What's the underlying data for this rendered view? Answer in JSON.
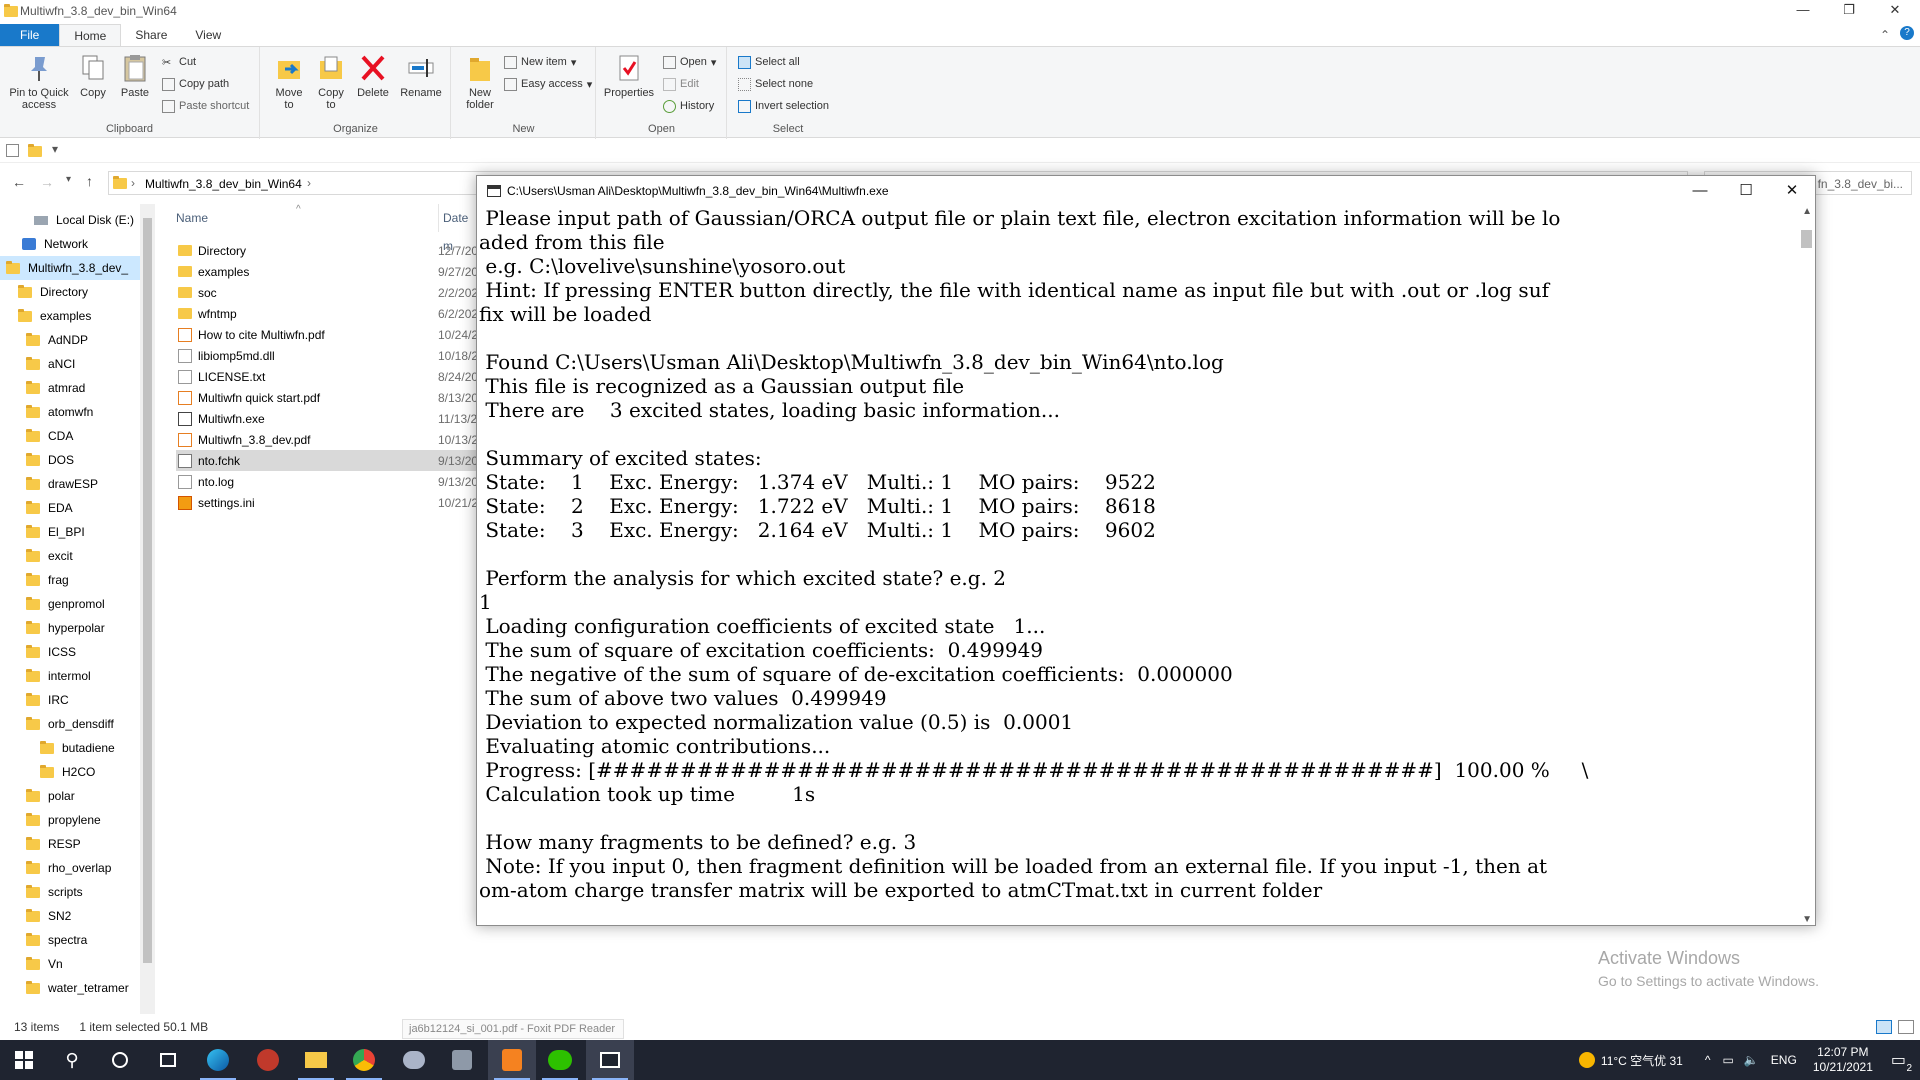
{
  "window": {
    "title": "Multiwfn_3.8_dev_bin_Win64"
  },
  "tabs": [
    "File",
    "Home",
    "Share",
    "View"
  ],
  "ribbon": {
    "clipboard": {
      "label": "Clipboard",
      "pin": "Pin to Quick access",
      "copy": "Copy",
      "paste": "Paste",
      "cut": "Cut",
      "copy_path": "Copy path",
      "paste_shortcut": "Paste shortcut"
    },
    "organize": {
      "label": "Organize",
      "move_to": "Move to",
      "copy_to": "Copy to",
      "delete": "Delete",
      "rename": "Rename"
    },
    "new": {
      "label": "New",
      "new_folder": "New folder",
      "new_item": "New item",
      "easy_access": "Easy access"
    },
    "open": {
      "label": "Open",
      "properties": "Properties",
      "open": "Open",
      "edit": "Edit",
      "history": "History"
    },
    "select": {
      "label": "Select",
      "select_all": "Select all",
      "select_none": "Select none",
      "invert": "Invert selection"
    }
  },
  "address": {
    "path": "Multiwfn_3.8_dev_bin_Win64",
    "search": "fn_3.8_dev_bi..."
  },
  "nav": {
    "items": [
      {
        "label": "Local Disk (E:)",
        "level": 1
      },
      {
        "label": "Network",
        "level": 0
      },
      {
        "label": "Multiwfn_3.8_dev_",
        "level": 0,
        "selected": true
      },
      {
        "label": "Directory",
        "level": 1
      },
      {
        "label": "examples",
        "level": 1
      },
      {
        "label": "AdNDP",
        "level": 2
      },
      {
        "label": "aNCI",
        "level": 2
      },
      {
        "label": "atmrad",
        "level": 2
      },
      {
        "label": "atomwfn",
        "level": 2
      },
      {
        "label": "CDA",
        "level": 2
      },
      {
        "label": "DOS",
        "level": 2
      },
      {
        "label": "drawESP",
        "level": 2
      },
      {
        "label": "EDA",
        "level": 2
      },
      {
        "label": "El_BPI",
        "level": 2
      },
      {
        "label": "excit",
        "level": 2
      },
      {
        "label": "frag",
        "level": 2
      },
      {
        "label": "genpromol",
        "level": 2
      },
      {
        "label": "hyperpolar",
        "level": 2
      },
      {
        "label": "ICSS",
        "level": 2
      },
      {
        "label": "intermol",
        "level": 2
      },
      {
        "label": "IRC",
        "level": 2
      },
      {
        "label": "orb_densdiff",
        "level": 2
      },
      {
        "label": "butadiene",
        "level": 3
      },
      {
        "label": "H2CO",
        "level": 3
      },
      {
        "label": "polar",
        "level": 2
      },
      {
        "label": "propylene",
        "level": 2
      },
      {
        "label": "RESP",
        "level": 2
      },
      {
        "label": "rho_overlap",
        "level": 2
      },
      {
        "label": "scripts",
        "level": 2
      },
      {
        "label": "SN2",
        "level": 2
      },
      {
        "label": "spectra",
        "level": 2
      },
      {
        "label": "Vn",
        "level": 2
      },
      {
        "label": "water_tetramer",
        "level": 2
      }
    ]
  },
  "files": {
    "headers": {
      "name": "Name",
      "date": "Date m"
    },
    "rows": [
      {
        "name": "Directory",
        "date": "12/7/20",
        "type": "folder"
      },
      {
        "name": "examples",
        "date": "9/27/20",
        "type": "folder"
      },
      {
        "name": "soc",
        "date": "2/2/202",
        "type": "folder"
      },
      {
        "name": "wfntmp",
        "date": "6/2/202",
        "type": "folder"
      },
      {
        "name": "How to cite Multiwfn.pdf",
        "date": "10/24/2",
        "type": "pdf"
      },
      {
        "name": "libiomp5md.dll",
        "date": "10/18/2",
        "type": "dll"
      },
      {
        "name": "LICENSE.txt",
        "date": "8/24/20",
        "type": "txt"
      },
      {
        "name": "Multiwfn quick start.pdf",
        "date": "8/13/20",
        "type": "pdf"
      },
      {
        "name": "Multiwfn.exe",
        "date": "11/13/2",
        "type": "exe"
      },
      {
        "name": "Multiwfn_3.8_dev.pdf",
        "date": "10/13/2",
        "type": "pdf"
      },
      {
        "name": "nto.fchk",
        "date": "9/13/20",
        "type": "fchk",
        "selected": true
      },
      {
        "name": "nto.log",
        "date": "9/13/20",
        "type": "txt"
      },
      {
        "name": "settings.ini",
        "date": "10/21/2",
        "type": "ini"
      }
    ]
  },
  "status": {
    "items": "13 items",
    "selected": "1 item selected  50.1 MB",
    "pdf_tip": "ja6b12124_si_001.pdf - Foxit PDF Reader"
  },
  "activate": {
    "line1": "Activate Windows",
    "line2": "Go to Settings to activate Windows."
  },
  "console": {
    "title": "C:\\Users\\Usman Ali\\Desktop\\Multiwfn_3.8_dev_bin_Win64\\Multiwfn.exe",
    "lines": [
      " Please input path of Gaussian/ORCA output file or plain text file, electron excitation information will be lo",
      "aded from this file",
      " e.g. C:\\lovelive\\sunshine\\yosoro.out",
      " Hint: If pressing ENTER button directly, the file with identical name as input file but with .out or .log suf",
      "fix will be loaded",
      "",
      " Found C:\\Users\\Usman Ali\\Desktop\\Multiwfn_3.8_dev_bin_Win64\\nto.log",
      " This file is recognized as a Gaussian output file",
      " There are    3 excited states, loading basic information...",
      "",
      " Summary of excited states:",
      " State:    1    Exc. Energy:   1.374 eV   Multi.: 1    MO pairs:    9522",
      " State:    2    Exc. Energy:   1.722 eV   Multi.: 1    MO pairs:    8618",
      " State:    3    Exc. Energy:   2.164 eV   Multi.: 1    MO pairs:    9602",
      "",
      " Perform the analysis for which excited state? e.g. 2",
      "1",
      " Loading configuration coefficients of excited state   1...",
      " The sum of square of excitation coefficients:  0.499949",
      " The negative of the sum of square of de-excitation coefficients:  0.000000",
      " The sum of above two values  0.499949",
      " Deviation to expected normalization value (0.5) is  0.0001",
      " Evaluating atomic contributions...",
      " Progress: [##################################################]  100.00 %     \\",
      " Calculation took up time         1s",
      "",
      " How many fragments to be defined? e.g. 3",
      " Note: If you input 0, then fragment definition will be loaded from an external file. If you input -1, then at",
      "om-atom charge transfer matrix will be exported to atmCTmat.txt in current folder"
    ]
  },
  "taskbar": {
    "weather": "11°C 空气优 31",
    "lang": "ENG",
    "time": "12:07 PM",
    "date": "10/21/2021",
    "notif": "2"
  },
  "colors": {
    "accent": "#1979ca",
    "taskbar": "#1f2430",
    "folder": "#f7c948"
  }
}
